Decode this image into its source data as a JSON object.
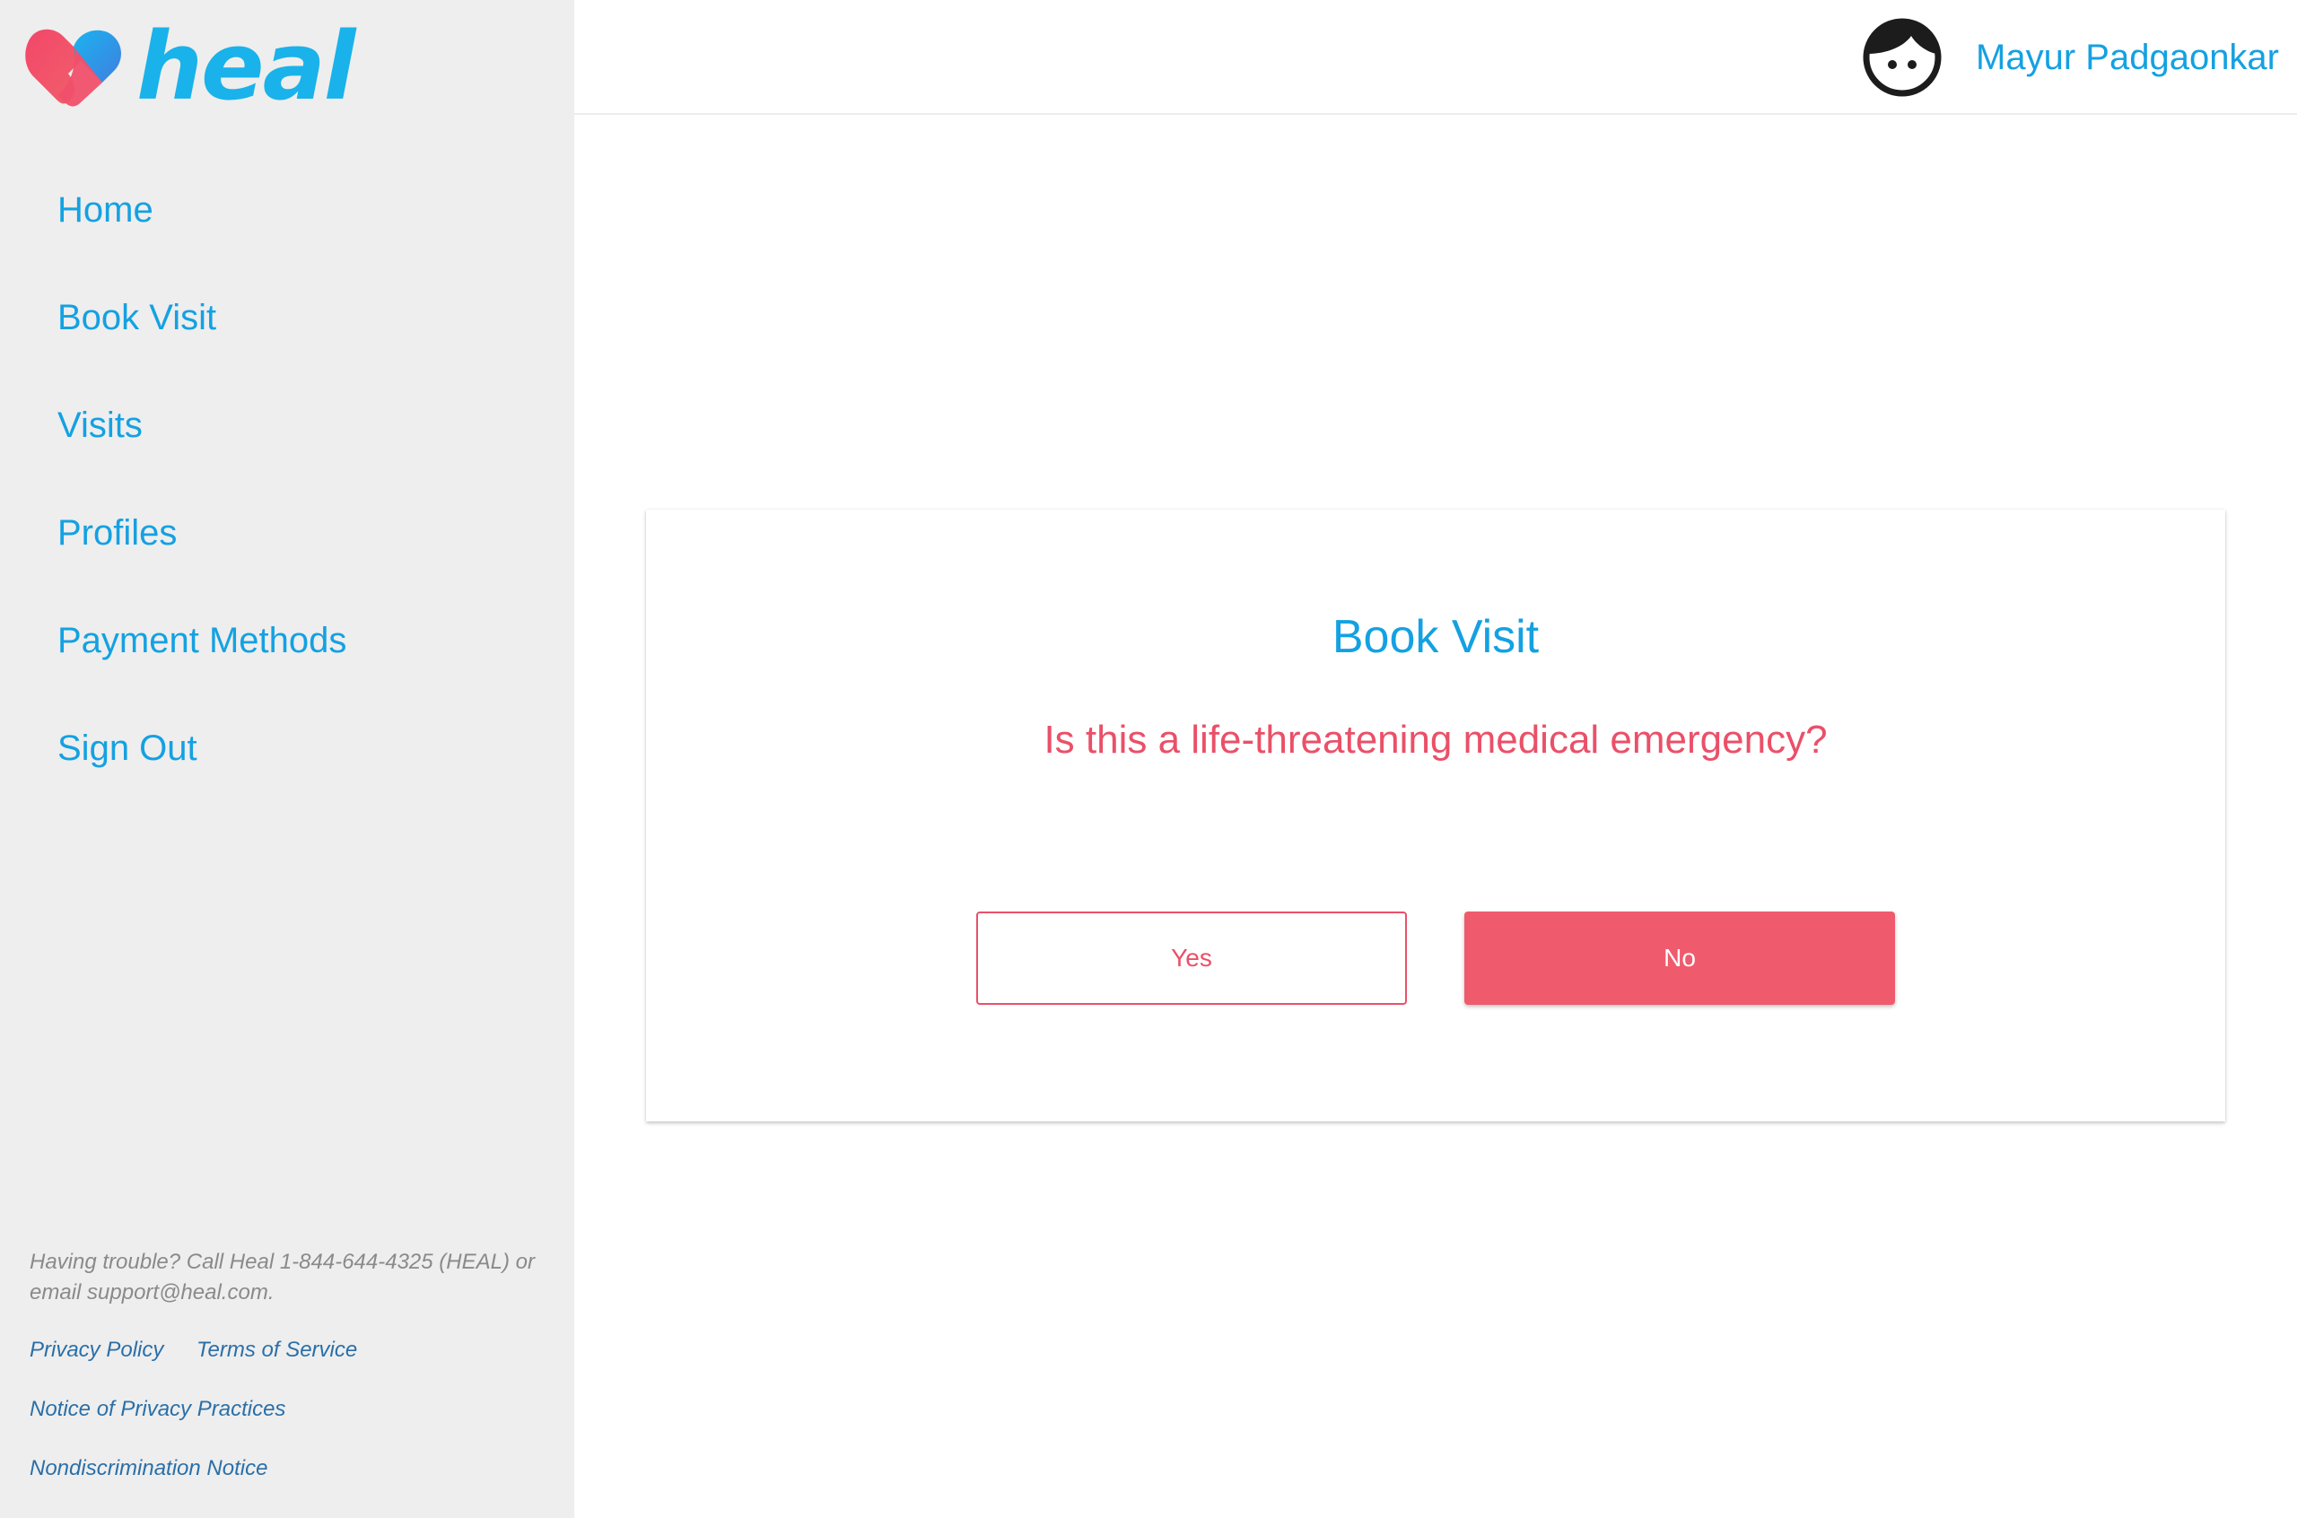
{
  "brand": {
    "name": "heal",
    "heart_colors": [
      "#f0506a",
      "#1ab2ea"
    ]
  },
  "sidebar": {
    "items": [
      {
        "label": "Home"
      },
      {
        "label": "Book Visit"
      },
      {
        "label": "Visits"
      },
      {
        "label": "Profiles"
      },
      {
        "label": "Payment Methods"
      },
      {
        "label": "Sign Out"
      }
    ],
    "help_text": "Having trouble? Call Heal 1-844-644-4325 (HEAL) or email support@heal.com.",
    "links": {
      "privacy_policy": "Privacy Policy",
      "terms_of_service": "Terms of Service",
      "notice_of_privacy_practices": "Notice of Privacy Practices",
      "nondiscrimination_notice": "Nondiscrimination Notice"
    }
  },
  "header": {
    "user_name": "Mayur Padgaonkar",
    "avatar_icon": "face-avatar-icon"
  },
  "main": {
    "title": "Book Visit",
    "question": "Is this a life-threatening medical emergency?",
    "yes_label": "Yes",
    "no_label": "No"
  },
  "colors": {
    "accent_blue": "#14a1e2",
    "accent_red": "#ea5068",
    "sidebar_bg": "#eeeeee"
  }
}
